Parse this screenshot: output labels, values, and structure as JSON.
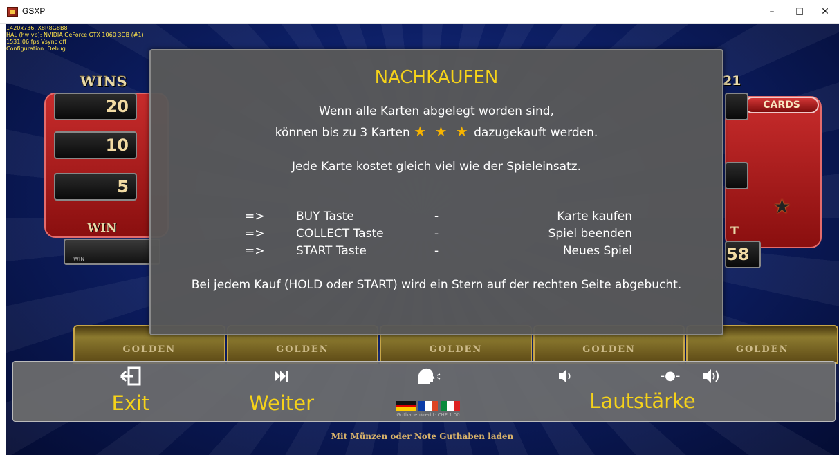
{
  "window": {
    "title": "GSXP",
    "minimize_glyph": "–",
    "maximize_glyph": "☐",
    "close_glyph": "✕"
  },
  "debug_overlay": {
    "lines": [
      "1420x736, X8R8G8B8",
      "HAL (hw vp): NVIDIA GeForce GTX 1060 3GB (#1)",
      "1531.06 fps  Vsync off",
      "Configuration: Debug"
    ]
  },
  "game_bg": {
    "wins_label": "WINS",
    "paytable_values": [
      "20",
      "10",
      "5"
    ],
    "win_label": "WIN",
    "win_box_label": "WIN",
    "right_number": "21",
    "cards_badge": "CARDS",
    "right_value": "58",
    "right_label_fragment": "T",
    "reel_labels": [
      "GOLDEN",
      "GOLDEN",
      "GOLDEN",
      "GOLDEN",
      "GOLDEN"
    ]
  },
  "modal": {
    "title": "NACHKAUFEN",
    "line1": "Wenn alle Karten abgelegt worden sind,",
    "line2_before": "können bis zu 3 Karten",
    "line2_stars": "★ ★ ★",
    "line2_after": "dazugekauft werden.",
    "line3": "Jede Karte kostet gleich viel wie der Spieleinsatz.",
    "rows": [
      {
        "arrow": "=>",
        "key": "BUY Taste",
        "dash": "-",
        "action": "Karte kaufen"
      },
      {
        "arrow": "=>",
        "key": "COLLECT Taste",
        "dash": "-",
        "action": "Spiel beenden"
      },
      {
        "arrow": "=>",
        "key": "START Taste",
        "dash": "-",
        "action": "Neues Spiel"
      }
    ],
    "bottom": "Bei jedem Kauf (HOLD oder START) wird ein Stern auf der rechten Seite abgebucht."
  },
  "controls": {
    "exit": {
      "icon": "exit-icon",
      "label": "Exit"
    },
    "next": {
      "icon": "fast-forward-icon",
      "label": "Weiter"
    },
    "language": {
      "icon": "speaking-head-icon",
      "credit_note": "Guthabenkredit: CHF 1.00"
    },
    "volume": {
      "label": "Lautstärke",
      "slider_glyph": "-●-"
    }
  },
  "footer_note": "Mit Münzen oder Note Guthaben laden",
  "colors": {
    "accent_yellow": "#f5d21a",
    "modal_bg": "#585858",
    "game_blue": "#0d1f66",
    "panel_red": "#c82c2c"
  }
}
